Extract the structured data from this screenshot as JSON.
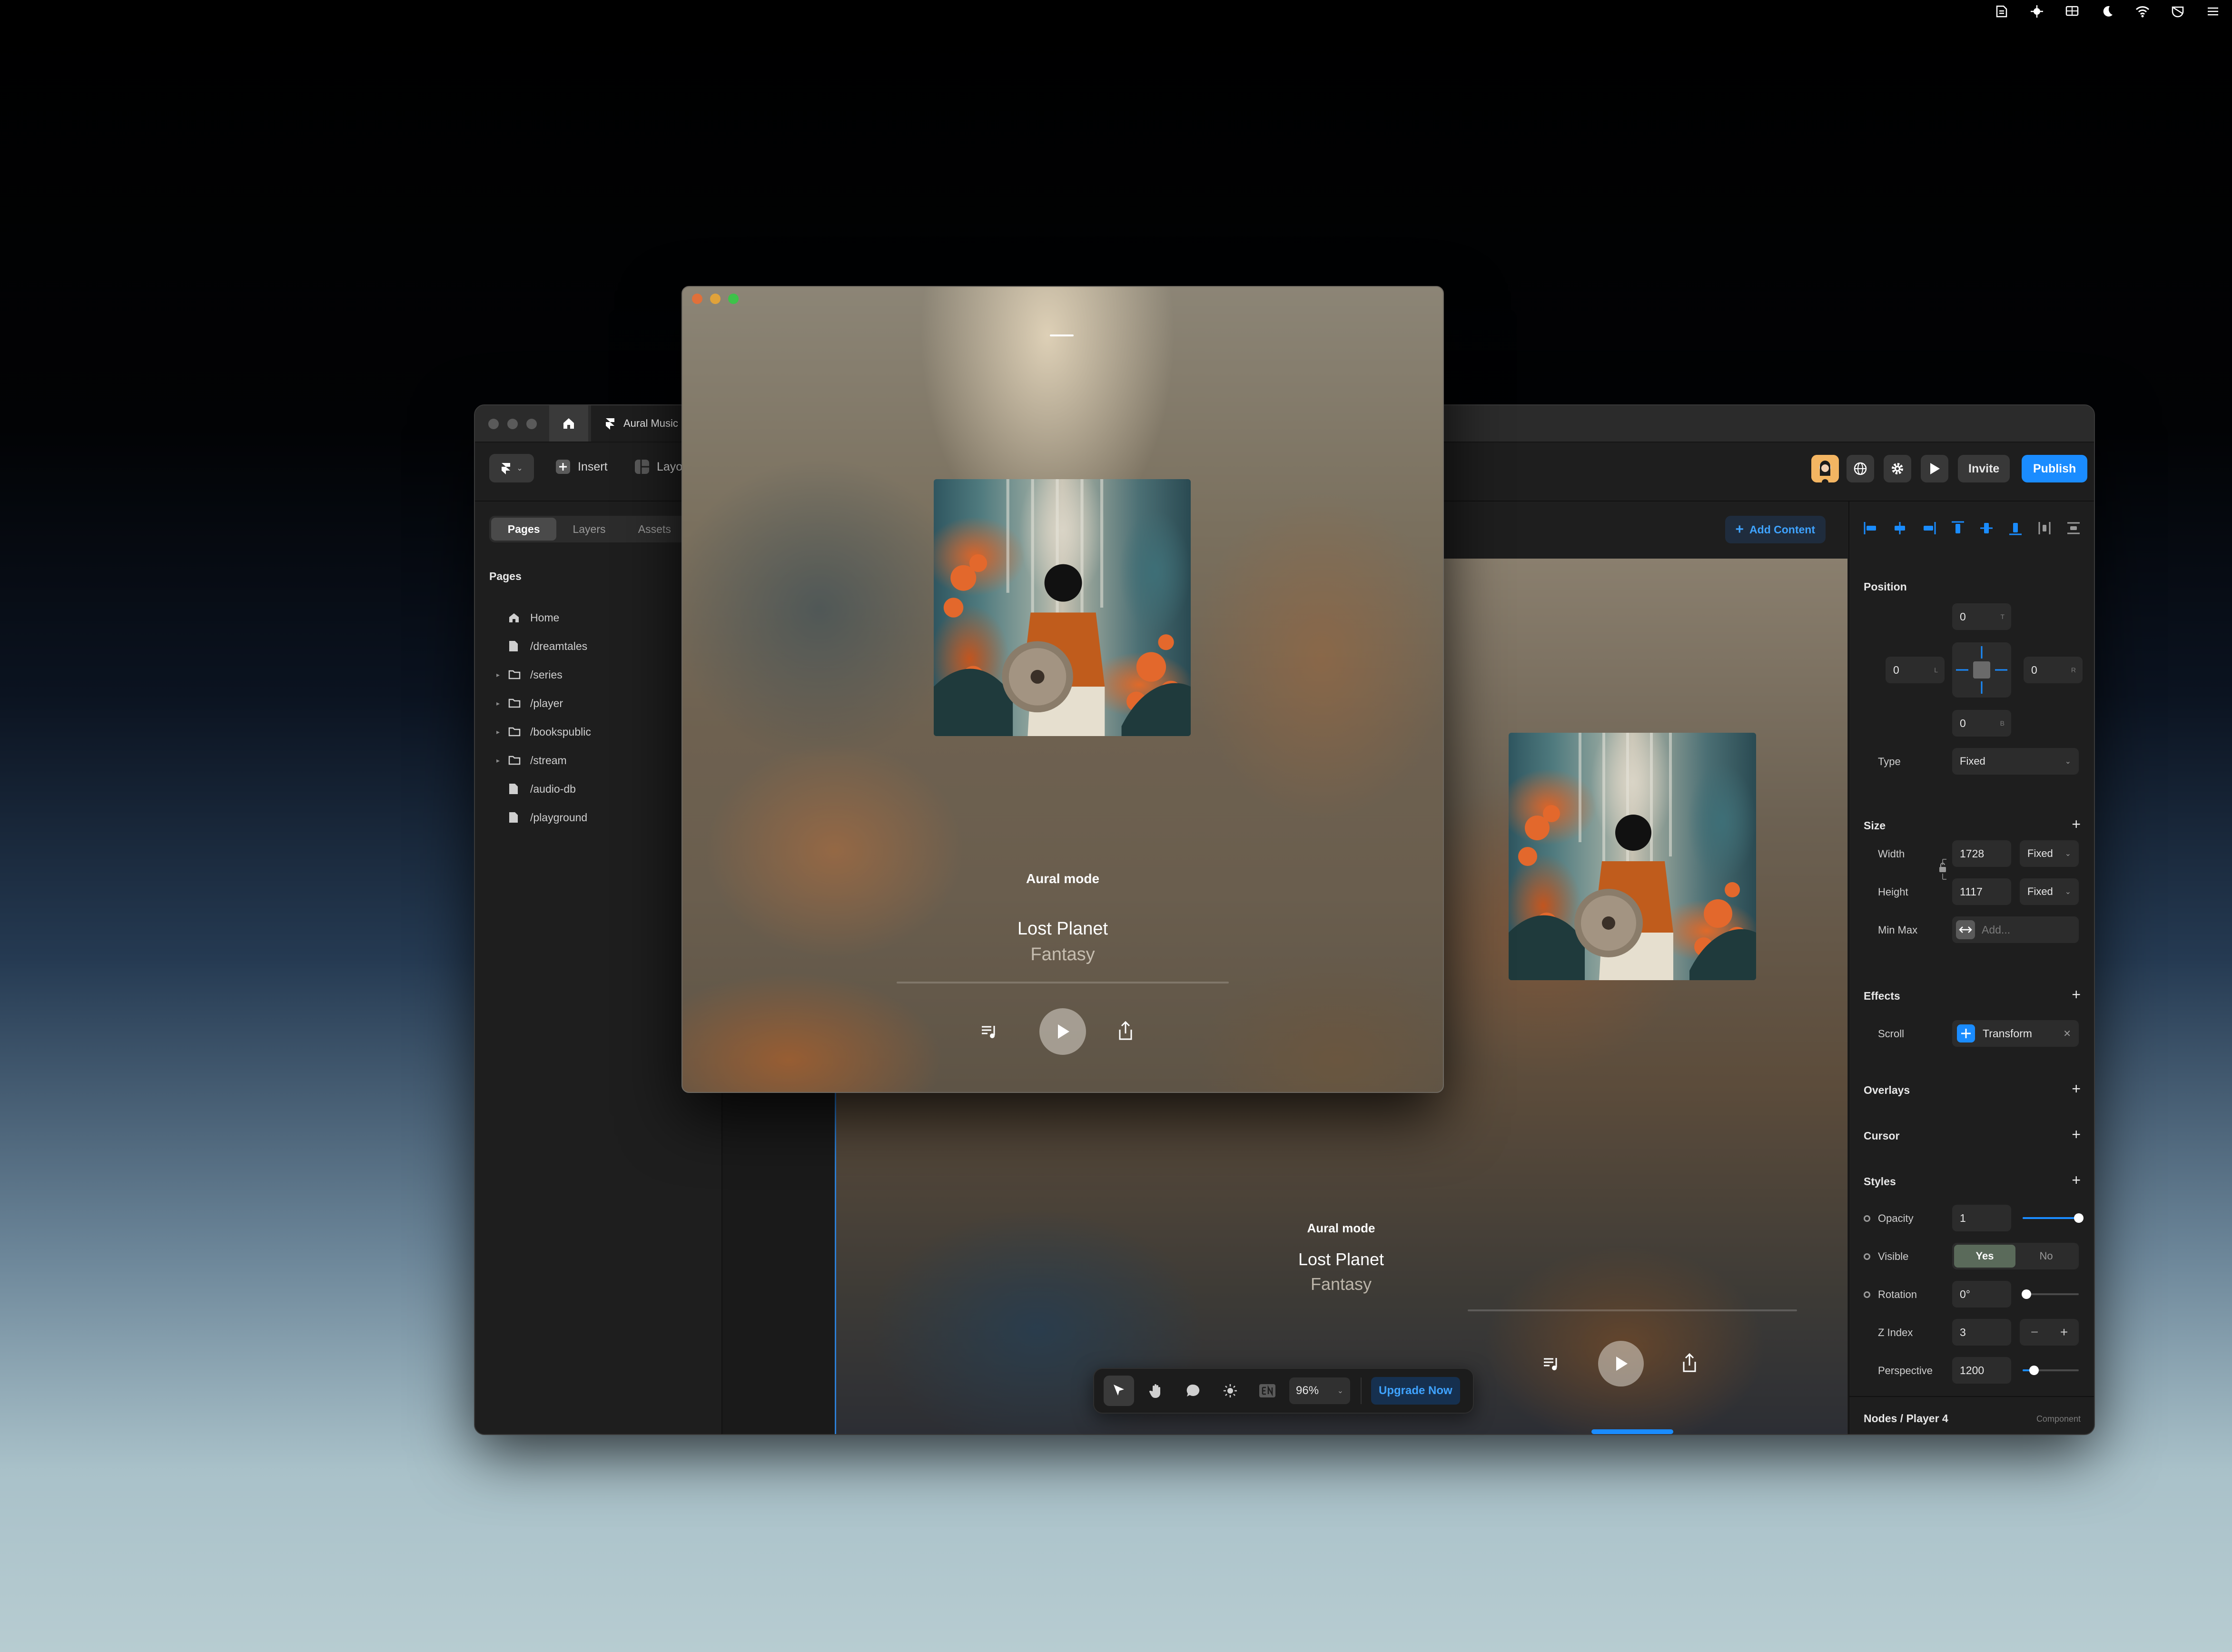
{
  "menubar": {
    "icons": [
      "app-icon-1",
      "app-icon-2",
      "display-icon",
      "moon-icon",
      "wifi-icon",
      "shield-icon",
      "control-center-icon"
    ]
  },
  "editor": {
    "tab_title": "Aural Music",
    "toolbar": {
      "insert": "Insert",
      "layout": "Layout",
      "invite": "Invite",
      "publish": "Publish"
    },
    "left": {
      "tabs": [
        "Pages",
        "Layers",
        "Assets"
      ],
      "heading": "Pages",
      "pages": [
        {
          "label": "Home",
          "icon": "home-icon",
          "expandable": false
        },
        {
          "label": "/dreamtales",
          "icon": "page-icon",
          "expandable": false
        },
        {
          "label": "/series",
          "icon": "folder-icon",
          "expandable": true
        },
        {
          "label": "/player",
          "icon": "folder-icon",
          "expandable": true
        },
        {
          "label": "/bookspublic",
          "icon": "folder-icon",
          "expandable": true
        },
        {
          "label": "/stream",
          "icon": "folder-icon",
          "expandable": true
        },
        {
          "label": "/audio-db",
          "icon": "page-icon",
          "expandable": false
        },
        {
          "label": "/playground",
          "icon": "page-icon",
          "expandable": false
        }
      ]
    },
    "canvas": {
      "add_content": "Add Content",
      "preview": {
        "mode": "Aural mode",
        "title": "Lost Planet",
        "subtitle": "Fantasy"
      },
      "float_toolbar": {
        "zoom": "96%",
        "upgrade": "Upgrade Now"
      }
    },
    "right": {
      "position": {
        "heading": "Position",
        "top": "0",
        "top_suffix": "T",
        "left": "0",
        "left_suffix": "L",
        "right": "0",
        "right_suffix": "R",
        "bottom": "0",
        "bottom_suffix": "B",
        "type_label": "Type",
        "type_value": "Fixed"
      },
      "size": {
        "heading": "Size",
        "width_label": "Width",
        "width_value": "1728",
        "width_mode": "Fixed",
        "height_label": "Height",
        "height_value": "1117",
        "height_mode": "Fixed",
        "minmax_label": "Min Max",
        "minmax_placeholder": "Add..."
      },
      "effects": {
        "heading": "Effects",
        "scroll_label": "Scroll",
        "scroll_value": "Transform"
      },
      "overlays": "Overlays",
      "cursor": "Cursor",
      "styles": {
        "heading": "Styles",
        "opacity_label": "Opacity",
        "opacity_value": "1",
        "opacity_level": 1.0,
        "visible_label": "Visible",
        "visible_yes": "Yes",
        "visible_no": "No",
        "rotation_label": "Rotation",
        "rotation_value": "0°",
        "zindex_label": "Z Index",
        "zindex_value": "3",
        "perspective_label": "Perspective",
        "perspective_value": "1200"
      },
      "footer": {
        "path": "Nodes / Player 4",
        "kind": "Component"
      }
    }
  },
  "player": {
    "mode": "Aural mode",
    "title": "Lost Planet",
    "subtitle": "Fantasy",
    "traffic_colors": [
      "#e0703a",
      "#e0a23a",
      "#3ec24a"
    ]
  },
  "colors": {
    "accent": "#1a8cff",
    "panel": "#1e1e1e"
  }
}
